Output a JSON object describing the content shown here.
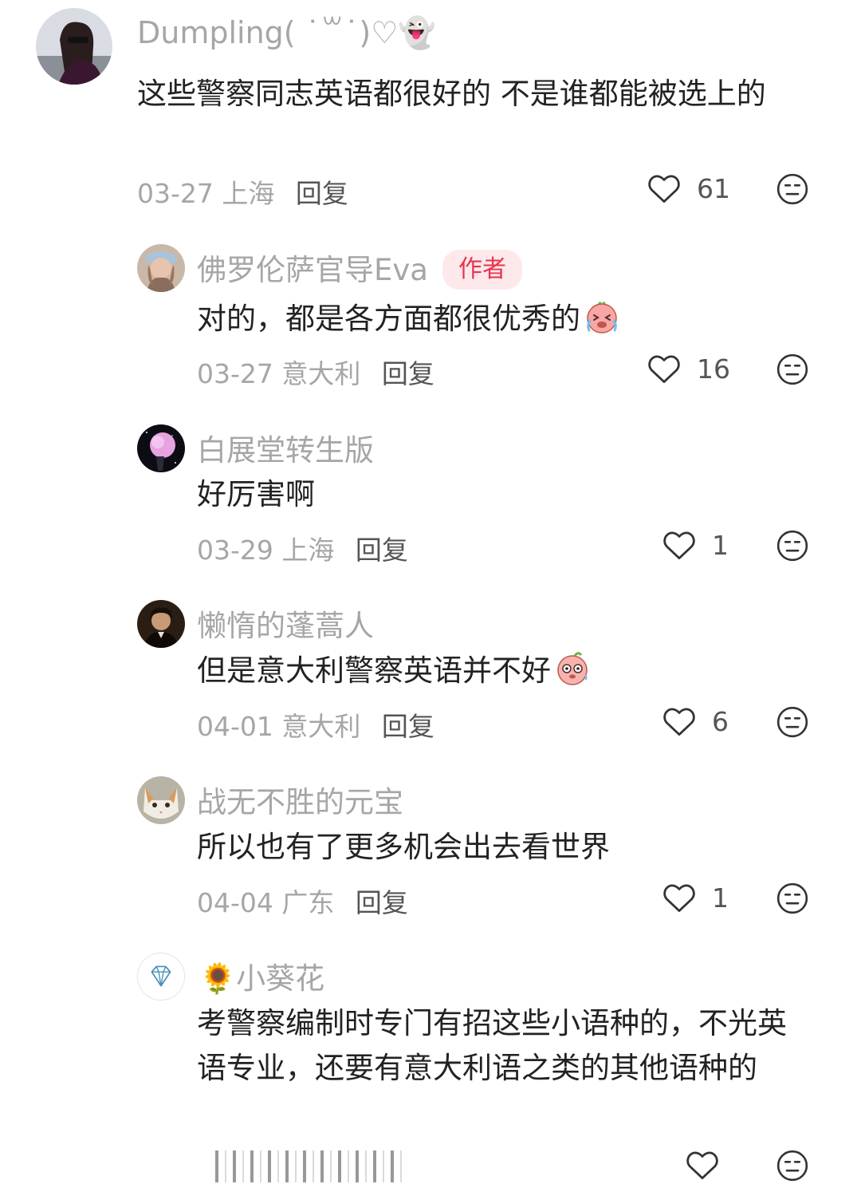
{
  "comments": [
    {
      "username": "Dumpling( ˙꒳˙)♡👻",
      "text": "这些警察同志英语都很好的 不是谁都能被选上的",
      "date": "03-27",
      "location": "上海",
      "reply": "回复",
      "likes": "61"
    },
    {
      "username": "佛罗伦萨官导Eva",
      "badge": "作者",
      "text": "对的，都是各方面都很优秀的",
      "date": "03-27",
      "location": "意大利",
      "reply": "回复",
      "likes": "16"
    },
    {
      "username": "白展堂转生版",
      "text": "好厉害啊",
      "date": "03-29",
      "location": "上海",
      "reply": "回复",
      "likes": "1"
    },
    {
      "username": "懒惰的蓬蒿人",
      "text": "但是意大利警察英语并不好",
      "date": "04-01",
      "location": "意大利",
      "reply": "回复",
      "likes": "6"
    },
    {
      "username": "战无不胜的元宝",
      "text": "所以也有了更多机会出去看世界",
      "date": "04-04",
      "location": "广东",
      "reply": "回复",
      "likes": "1"
    },
    {
      "username": "🌻小葵花",
      "text": "考警察编制时专门有招这些小语种的，不光英语专业，还要有意大利语之类的其他语种的"
    }
  ],
  "colors": {
    "muted": "#a6a6a6",
    "badge_bg": "#fde8ec",
    "badge_text": "#e8334a"
  },
  "icons": {
    "like": "heart-outline-icon",
    "dislike": "meh-face-icon"
  }
}
